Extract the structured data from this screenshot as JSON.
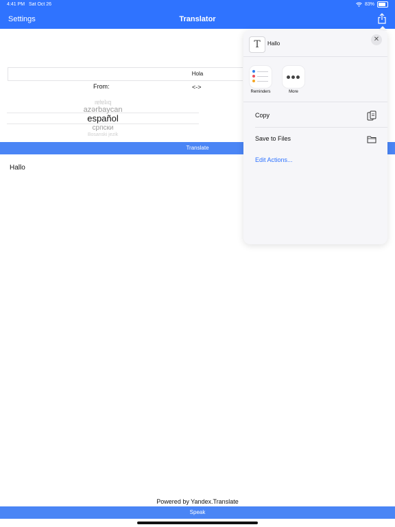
{
  "status_bar": {
    "time": "4:41 PM",
    "date": "Sat Oct 26",
    "battery": "83%"
  },
  "nav": {
    "left": "Settings",
    "title": "Translator",
    "share_icon": "share-icon"
  },
  "input": {
    "text": "Hola"
  },
  "from_label": "From:",
  "swap_label": "<->",
  "picker": {
    "options": [
      "ıɐlɐʇıq",
      "azərbaycan",
      "español",
      "српски",
      "Bosanski jezik"
    ],
    "selected": "español"
  },
  "translate_button": "Translate",
  "output": {
    "text": "Hallo"
  },
  "footer": {
    "powered_by": "Powered by Yandex.Translate",
    "speak_button": "Speak"
  },
  "share_sheet": {
    "title": "Hallo",
    "apps": [
      {
        "label": "Reminders"
      },
      {
        "label": "More"
      }
    ],
    "actions": [
      {
        "label": "Copy",
        "icon": "copy-icon"
      },
      {
        "label": "Save to Files",
        "icon": "folder-icon"
      }
    ],
    "edit_actions": "Edit Actions..."
  },
  "colors": {
    "accent": "#2f73ff",
    "button_bar": "#4a85f5"
  }
}
